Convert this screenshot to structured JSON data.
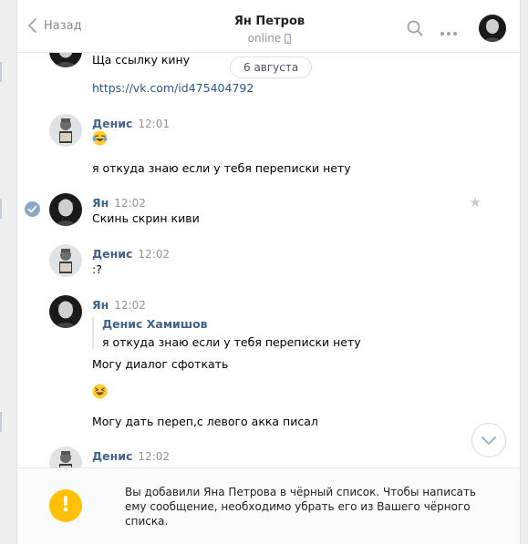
{
  "header": {
    "back_label": "Назад",
    "peer_name": "Ян Петров",
    "peer_status": "online"
  },
  "date_pill": "6 августа",
  "messages": [
    {
      "text": "Ща ссылку кину",
      "link": "https://vk.com/id475404792"
    },
    {
      "author": "Денис",
      "time": "12:01",
      "emoji": "laughing-tears",
      "text": "я откуда знаю если у тебя переписки нету"
    },
    {
      "author": "Ян",
      "time": "12:02",
      "text": "Скинь скрин киви"
    },
    {
      "author": "Денис",
      "time": "12:02",
      "text": ":?"
    },
    {
      "author": "Ян",
      "time": "12:02",
      "reply_author": "Денис Хамишов",
      "reply_text": "я откуда знаю если у тебя переписки нету",
      "text": "Могу диалог сфоткать",
      "emoji": "grinning-squint",
      "text2": "Могу дать переп,с левого акка писал"
    },
    {
      "author": "Денис",
      "time": "12:02"
    }
  ],
  "footer": {
    "warning": "Вы добавили Яна Петрова в чёрный список. Чтобы написать ему сообщение, необходимо убрать его из Вашего чёрного списка.",
    "warning_icon_glyph": "!"
  },
  "icons": {
    "back": "chevron-left-icon",
    "search": "search-icon",
    "more": "more-dots-icon",
    "mobile": "mobile-phone-icon",
    "scroll_down": "chevron-down-icon",
    "selected": "check-circle-icon",
    "favorite": "star-icon",
    "warning": "warning-icon"
  },
  "colors": {
    "link": "#2a5885",
    "author": "#42648b",
    "warning": "#ffc107",
    "muted": "#939393"
  }
}
